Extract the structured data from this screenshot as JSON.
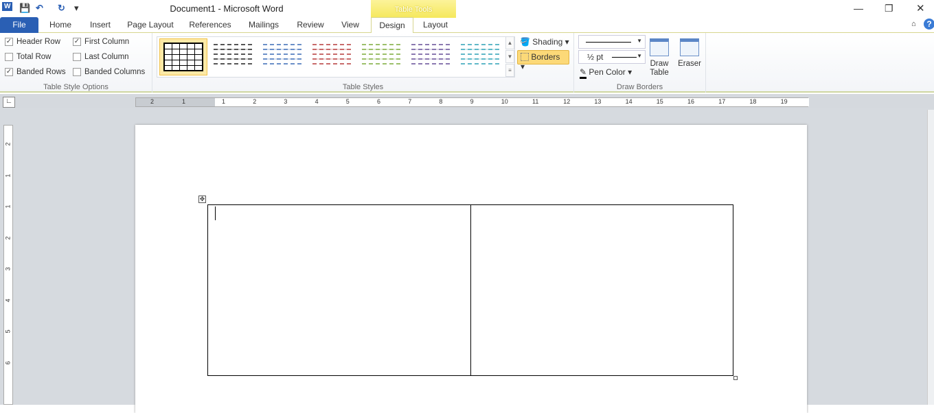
{
  "window": {
    "title": "Document1  -  Microsoft Word",
    "contextual_tab": "Table Tools",
    "minimize": "—",
    "restore": "❐",
    "close": "✕",
    "help": "?"
  },
  "quick_access": {
    "word_icon": "W",
    "save": "💾",
    "undo": "↶",
    "redo": "↻",
    "customize": "▾"
  },
  "tabs": [
    "File",
    "Home",
    "Insert",
    "Page Layout",
    "References",
    "Mailings",
    "Review",
    "View",
    "Design",
    "Layout"
  ],
  "active_tab": "Design",
  "table_style_options": {
    "label": "Table Style Options",
    "items": [
      {
        "label": "Header Row",
        "checked": true
      },
      {
        "label": "Total Row",
        "checked": false
      },
      {
        "label": "Banded Rows",
        "checked": true
      },
      {
        "label": "First Column",
        "checked": true
      },
      {
        "label": "Last Column",
        "checked": false
      },
      {
        "label": "Banded Columns",
        "checked": false
      }
    ]
  },
  "table_styles": {
    "label": "Table Styles",
    "colors": [
      "#000000",
      "#555555",
      "#6a8fc8",
      "#c86a6a",
      "#9cbf6a",
      "#8a78b0",
      "#5fb8c8"
    ],
    "shading": "Shading",
    "borders": "Borders"
  },
  "draw_borders": {
    "label": "Draw Borders",
    "pen_weight": "½ pt",
    "pen_color": "Pen Color",
    "draw_table": "Draw Table",
    "eraser": "Eraser"
  },
  "ruler": {
    "h_left": [
      "2",
      "1"
    ],
    "h": [
      "1",
      "2",
      "3",
      "4",
      "5",
      "6",
      "7",
      "8",
      "9",
      "10",
      "11",
      "12",
      "13",
      "14",
      "15",
      "16",
      "17",
      "18",
      "19"
    ],
    "v": [
      "2",
      "1",
      "1",
      "2",
      "3",
      "4",
      "5",
      "6"
    ]
  }
}
